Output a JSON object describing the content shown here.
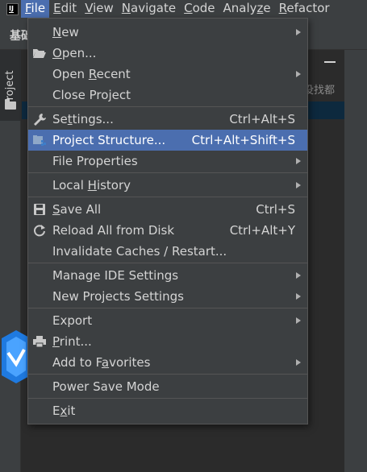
{
  "menubar": {
    "items": [
      "File",
      "Edit",
      "View",
      "Navigate",
      "Code",
      "Analyze",
      "Refactor"
    ],
    "active_index": 0,
    "mnemonics": [
      "F",
      "E",
      "V",
      "N",
      "C",
      "z",
      "R"
    ]
  },
  "toolbar": {
    "project_name": "基础"
  },
  "tool_window": {
    "project_tab": "Project"
  },
  "editor": {
    "faint_text": "没找都"
  },
  "file_menu": {
    "items": [
      {
        "label": "New",
        "mnemonic": "N",
        "shortcut": "",
        "submenu": true,
        "icon": ""
      },
      {
        "label": "Open...",
        "mnemonic": "O",
        "shortcut": "",
        "submenu": false,
        "icon": "folder-open-icon"
      },
      {
        "label": "Open Recent",
        "mnemonic": "R",
        "shortcut": "",
        "submenu": true,
        "icon": ""
      },
      {
        "label": "Close Project",
        "mnemonic": "j",
        "shortcut": "",
        "submenu": false,
        "icon": ""
      },
      {
        "sep": true
      },
      {
        "label": "Settings...",
        "mnemonic": "t",
        "shortcut": "Ctrl+Alt+S",
        "submenu": false,
        "icon": "wrench-icon"
      },
      {
        "label": "Project Structure...",
        "mnemonic": "",
        "shortcut": "Ctrl+Alt+Shift+S",
        "submenu": false,
        "icon": "project-structure-icon",
        "highlighted": true
      },
      {
        "label": "File Properties",
        "mnemonic": "",
        "shortcut": "",
        "submenu": true,
        "icon": ""
      },
      {
        "sep": true
      },
      {
        "label": "Local History",
        "mnemonic": "H",
        "shortcut": "",
        "submenu": true,
        "icon": ""
      },
      {
        "sep": true
      },
      {
        "label": "Save All",
        "mnemonic": "S",
        "shortcut": "Ctrl+S",
        "submenu": false,
        "icon": "save-icon"
      },
      {
        "label": "Reload All from Disk",
        "mnemonic": "",
        "shortcut": "Ctrl+Alt+Y",
        "submenu": false,
        "icon": "reload-icon"
      },
      {
        "label": "Invalidate Caches / Restart...",
        "mnemonic": "",
        "shortcut": "",
        "submenu": false,
        "icon": ""
      },
      {
        "sep": true
      },
      {
        "label": "Manage IDE Settings",
        "mnemonic": "",
        "shortcut": "",
        "submenu": true,
        "icon": ""
      },
      {
        "label": "New Projects Settings",
        "mnemonic": "",
        "shortcut": "",
        "submenu": true,
        "icon": ""
      },
      {
        "sep": true
      },
      {
        "label": "Export",
        "mnemonic": "",
        "shortcut": "",
        "submenu": true,
        "icon": ""
      },
      {
        "label": "Print...",
        "mnemonic": "P",
        "shortcut": "",
        "submenu": false,
        "icon": "print-icon"
      },
      {
        "label": "Add to Favorites",
        "mnemonic": "a",
        "shortcut": "",
        "submenu": true,
        "icon": ""
      },
      {
        "sep": true
      },
      {
        "label": "Power Save Mode",
        "mnemonic": "",
        "shortcut": "",
        "submenu": false,
        "icon": ""
      },
      {
        "sep": true
      },
      {
        "label": "Exit",
        "mnemonic": "x",
        "shortcut": "",
        "submenu": false,
        "icon": ""
      }
    ]
  },
  "colors": {
    "menu_bg": "#3c3f41",
    "highlight": "#4b6eaf",
    "editor_bg": "#2b2b2b",
    "text": "#d4d4d4"
  }
}
